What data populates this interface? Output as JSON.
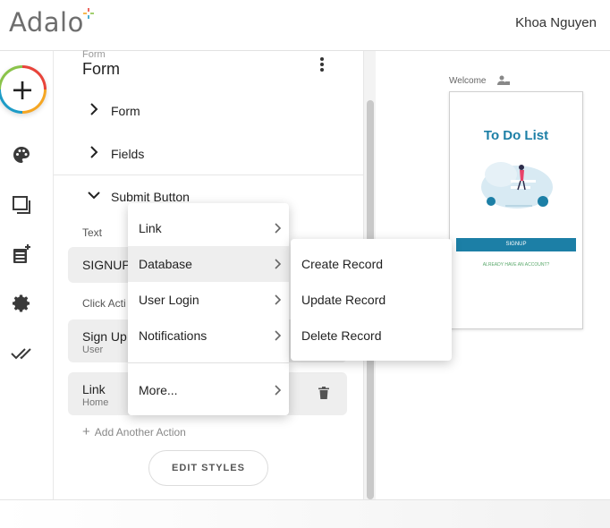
{
  "app": {
    "logo": "Adalo",
    "user_name": "Khoa Nguyen"
  },
  "rail": {
    "items": [
      "add-icon",
      "palette-icon",
      "screens-icon",
      "database-icon",
      "gear-icon",
      "double-check-icon"
    ]
  },
  "panel": {
    "breadcrumb": "Form",
    "title": "Form",
    "sections": [
      {
        "label": "Form",
        "expanded": false
      },
      {
        "label": "Fields",
        "expanded": false
      },
      {
        "label": "Submit Button",
        "expanded": true
      }
    ],
    "text_label": "Text",
    "text_value": "SIGNUP",
    "click_actions_label": "Click Acti",
    "actions": [
      {
        "title": "Sign Up",
        "subtitle": "User"
      },
      {
        "title": "Link",
        "subtitle": "Home"
      }
    ],
    "add_action_label": "Add Another Action",
    "edit_styles_label": "EDIT STYLES"
  },
  "canvas": {
    "screen_name": "Welcome",
    "phone": {
      "title": "To Do List",
      "signup_button": "SIGNUP",
      "already_link": "ALREADY HAVE AN ACCOUNT?"
    }
  },
  "menu": {
    "items": [
      {
        "label": "Link"
      },
      {
        "label": "Database",
        "active": true
      },
      {
        "label": "User Login"
      },
      {
        "label": "Notifications"
      },
      {
        "label": "More..."
      }
    ],
    "submenu": [
      {
        "label": "Create Record"
      },
      {
        "label": "Update Record"
      },
      {
        "label": "Delete Record"
      }
    ]
  },
  "colors": {
    "brand": "#1c7fa6",
    "accent_green": "#5aa86b"
  }
}
